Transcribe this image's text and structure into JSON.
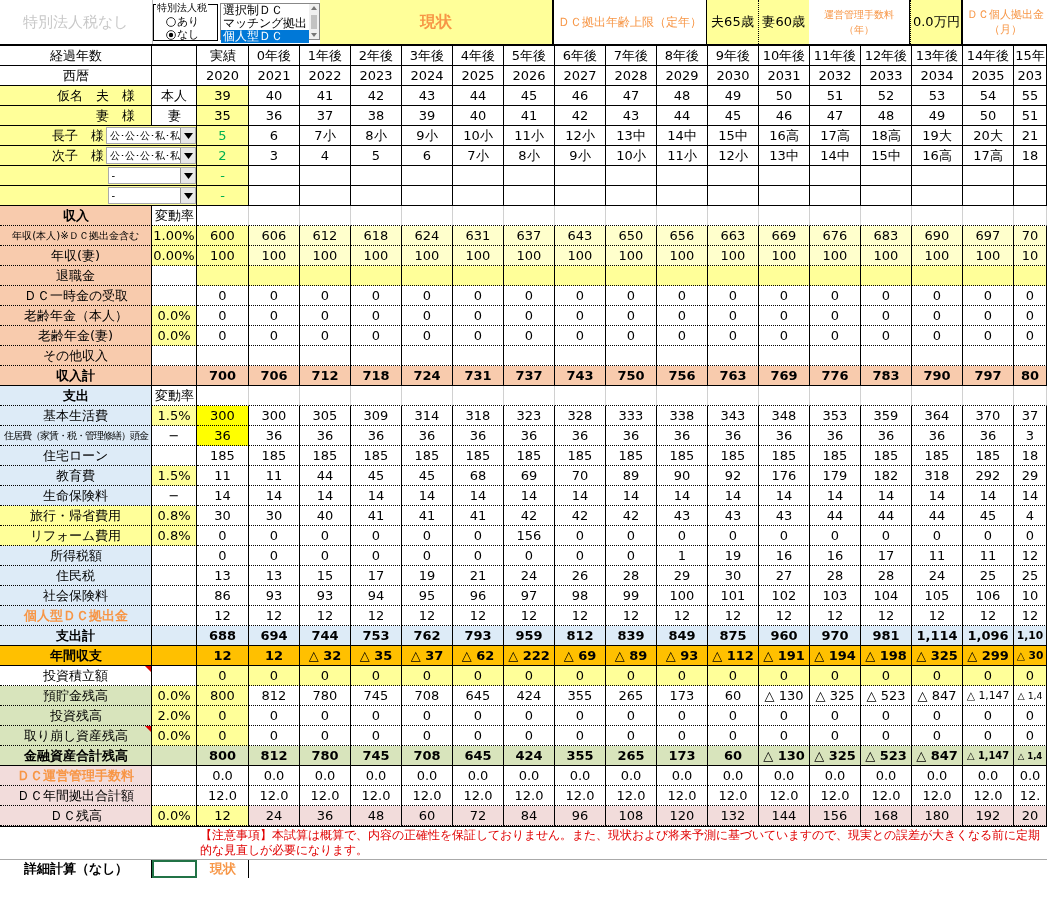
{
  "top_bar": {
    "notice": "特別法人税なし",
    "tax_option": {
      "title": "特別法人税",
      "options": [
        {
          "label": "あり",
          "selected": false
        },
        {
          "label": "なし",
          "selected": true
        }
      ]
    },
    "plan_list": [
      {
        "label": "選択制ＤＣ",
        "selected": false
      },
      {
        "label": "マッチング拠出",
        "selected": false
      },
      {
        "label": "個人型ＤＣ",
        "selected": true
      }
    ],
    "status": "現状",
    "dc_age_label": "ＤＣ拠出年齢上限（定年）",
    "husband_age": "夫65歳",
    "wife_age": "妻60歳",
    "fee_label": [
      "運営管理手数料",
      "（年）"
    ],
    "fee_value": "0.0万円",
    "contribution_label": [
      "ＤＣ個人拠出金",
      "（月）"
    ]
  },
  "elapsed_label": "経過年数",
  "year_label": "西暦",
  "columns": [
    "実績",
    "0年後",
    "1年後",
    "2年後",
    "3年後",
    "4年後",
    "5年後",
    "6年後",
    "7年後",
    "8年後",
    "9年後",
    "10年後",
    "11年後",
    "12年後",
    "13年後",
    "14年後",
    "15年"
  ],
  "years": [
    "2020",
    "2021",
    "2022",
    "2023",
    "2024",
    "2025",
    "2026",
    "2027",
    "2028",
    "2029",
    "2030",
    "2031",
    "2032",
    "2033",
    "2034",
    "2035",
    "203"
  ],
  "members": [
    {
      "kind": "adult",
      "name": "仮名　夫　様",
      "relation": "本人",
      "current": "39",
      "ages": [
        "40",
        "41",
        "42",
        "43",
        "44",
        "45",
        "46",
        "47",
        "48",
        "49",
        "50",
        "51",
        "52",
        "53",
        "54",
        "55"
      ]
    },
    {
      "kind": "adult",
      "name": "妻　様",
      "relation": "妻",
      "current": "35",
      "ages": [
        "36",
        "37",
        "38",
        "39",
        "40",
        "41",
        "42",
        "43",
        "44",
        "45",
        "46",
        "47",
        "48",
        "49",
        "50",
        "51"
      ]
    },
    {
      "kind": "child",
      "name": "長子　様",
      "school": "公･公･公･私･私",
      "current": "5",
      "ages": [
        "6",
        "7小",
        "8小",
        "9小",
        "10小",
        "11小",
        "12小",
        "13中",
        "14中",
        "15中",
        "16高",
        "17高",
        "18高",
        "19大",
        "20大",
        "21"
      ]
    },
    {
      "kind": "child",
      "name": "次子　様",
      "school": "公･公･公･私･私",
      "current": "2",
      "ages": [
        "3",
        "4",
        "5",
        "6",
        "7小",
        "8小",
        "9小",
        "10小",
        "11小",
        "12小",
        "13中",
        "14中",
        "15中",
        "16高",
        "17高",
        "18"
      ]
    },
    {
      "kind": "child",
      "school": "-",
      "current": "-"
    },
    {
      "kind": "child",
      "school": "-",
      "current": "-"
    }
  ],
  "rows": [
    {
      "kind": "heading-income",
      "label": "収入",
      "rate": "変動率",
      "note_mark": false
    },
    {
      "kind": "salary",
      "label": "年収(本人)※ＤＣ拠出金含む",
      "rate": "1.00%",
      "rate_input": true,
      "note_mark": false,
      "values": [
        "600",
        "606",
        "612",
        "618",
        "624",
        "631",
        "637",
        "643",
        "650",
        "656",
        "663",
        "669",
        "676",
        "683",
        "690",
        "697",
        "70"
      ]
    },
    {
      "kind": "salary",
      "label": "年収(妻)",
      "rate": "0.00%",
      "rate_input": true,
      "note_mark": false,
      "values": [
        "100",
        "100",
        "100",
        "100",
        "100",
        "100",
        "100",
        "100",
        "100",
        "100",
        "100",
        "100",
        "100",
        "100",
        "100",
        "100",
        "10"
      ]
    },
    {
      "kind": "lump",
      "label": "退職金",
      "note_mark": false
    },
    {
      "kind": "income",
      "label": "ＤＣ一時金の受取",
      "note_mark": false,
      "values": [
        "0",
        "0",
        "0",
        "0",
        "0",
        "0",
        "0",
        "0",
        "0",
        "0",
        "0",
        "0",
        "0",
        "0",
        "0",
        "0",
        "0"
      ]
    },
    {
      "kind": "income",
      "label": "老齢年金（本人）",
      "rate": "0.0%",
      "rate_input": true,
      "note_mark": false,
      "values": [
        "0",
        "0",
        "0",
        "0",
        "0",
        "0",
        "0",
        "0",
        "0",
        "0",
        "0",
        "0",
        "0",
        "0",
        "0",
        "0",
        "0"
      ]
    },
    {
      "kind": "income",
      "label": "老齢年金(妻)",
      "rate": "0.0%",
      "rate_input": true,
      "note_mark": false,
      "values": [
        "0",
        "0",
        "0",
        "0",
        "0",
        "0",
        "0",
        "0",
        "0",
        "0",
        "0",
        "0",
        "0",
        "0",
        "0",
        "0",
        "0"
      ]
    },
    {
      "kind": "income",
      "label": "その他収入",
      "note_mark": false
    },
    {
      "kind": "income-total",
      "label": "収入計",
      "note_mark": false,
      "values": [
        "700",
        "706",
        "712",
        "718",
        "724",
        "731",
        "737",
        "743",
        "750",
        "756",
        "763",
        "769",
        "776",
        "783",
        "790",
        "797",
        "80"
      ]
    },
    {
      "kind": "heading-expense",
      "label": "支出",
      "rate": "変動率",
      "note_mark": false
    },
    {
      "kind": "expense-input",
      "label": "基本生活費",
      "rate": "1.5%",
      "rate_input": true,
      "note_mark": false,
      "values": [
        "300",
        "300",
        "305",
        "309",
        "314",
        "318",
        "323",
        "328",
        "333",
        "338",
        "343",
        "348",
        "353",
        "359",
        "364",
        "370",
        "37"
      ]
    },
    {
      "kind": "expense-input",
      "label": "住居費（家賃・税・管理修繕）頭金",
      "rate": "−",
      "rate_input": false,
      "note_mark": false,
      "values": [
        "36",
        "36",
        "36",
        "36",
        "36",
        "36",
        "36",
        "36",
        "36",
        "36",
        "36",
        "36",
        "36",
        "36",
        "36",
        "36",
        "3"
      ]
    },
    {
      "kind": "expense",
      "label": "住宅ローン",
      "note_mark": false,
      "values": [
        "185",
        "185",
        "185",
        "185",
        "185",
        "185",
        "185",
        "185",
        "185",
        "185",
        "185",
        "185",
        "185",
        "185",
        "185",
        "185",
        "18"
      ]
    },
    {
      "kind": "expense",
      "label": "教育費",
      "rate": "1.5%",
      "rate_input": true,
      "note_mark": false,
      "values": [
        "11",
        "11",
        "44",
        "45",
        "45",
        "68",
        "69",
        "70",
        "89",
        "90",
        "92",
        "176",
        "179",
        "182",
        "318",
        "292",
        "29"
      ]
    },
    {
      "kind": "expense",
      "label": "生命保険料",
      "rate": "−",
      "rate_input": false,
      "note_mark": false,
      "values": [
        "14",
        "14",
        "14",
        "14",
        "14",
        "14",
        "14",
        "14",
        "14",
        "14",
        "14",
        "14",
        "14",
        "14",
        "14",
        "14",
        "14"
      ]
    },
    {
      "kind": "expense-alt",
      "label": "旅行・帰省費用",
      "rate": "0.8%",
      "rate_input": true,
      "note_mark": false,
      "values": [
        "30",
        "30",
        "40",
        "41",
        "41",
        "41",
        "42",
        "42",
        "42",
        "43",
        "43",
        "43",
        "44",
        "44",
        "44",
        "45",
        "4"
      ]
    },
    {
      "kind": "expense-alt",
      "label": "リフォーム費用",
      "rate": "0.8%",
      "rate_input": true,
      "note_mark": false,
      "values": [
        "0",
        "0",
        "0",
        "0",
        "0",
        "0",
        "156",
        "0",
        "0",
        "0",
        "0",
        "0",
        "0",
        "0",
        "0",
        "0",
        "0"
      ]
    },
    {
      "kind": "expense",
      "label": "所得税額",
      "note_mark": false,
      "values": [
        "0",
        "0",
        "0",
        "0",
        "0",
        "0",
        "0",
        "0",
        "0",
        "1",
        "19",
        "16",
        "16",
        "17",
        "11",
        "11",
        "12"
      ]
    },
    {
      "kind": "expense",
      "label": "住民税",
      "note_mark": false,
      "values": [
        "13",
        "13",
        "15",
        "17",
        "19",
        "21",
        "24",
        "26",
        "28",
        "29",
        "30",
        "27",
        "28",
        "28",
        "24",
        "25",
        "25"
      ]
    },
    {
      "kind": "expense",
      "label": "社会保険料",
      "note_mark": false,
      "values": [
        "86",
        "93",
        "93",
        "94",
        "95",
        "96",
        "97",
        "98",
        "99",
        "100",
        "101",
        "102",
        "103",
        "104",
        "105",
        "106",
        "10"
      ]
    },
    {
      "kind": "expense-dc",
      "label": "個人型ＤＣ拠出金",
      "note_mark": false,
      "values": [
        "12",
        "12",
        "12",
        "12",
        "12",
        "12",
        "12",
        "12",
        "12",
        "12",
        "12",
        "12",
        "12",
        "12",
        "12",
        "12",
        "12"
      ]
    },
    {
      "kind": "expense-total",
      "label": "支出計",
      "note_mark": false,
      "values": [
        "688",
        "694",
        "744",
        "753",
        "762",
        "793",
        "959",
        "812",
        "839",
        "849",
        "875",
        "960",
        "970",
        "981",
        "1,114",
        "1,096",
        "1,10"
      ]
    },
    {
      "kind": "net",
      "label": "年間収支",
      "note_mark": false,
      "values": [
        "12",
        "12",
        "△ 32",
        "△ 35",
        "△ 37",
        "△ 62",
        "△ 222",
        "△ 69",
        "△ 89",
        "△ 93",
        "△ 112",
        "△ 191",
        "△ 194",
        "△ 198",
        "△ 325",
        "△ 299",
        "△ 30"
      ]
    },
    {
      "kind": "invest",
      "label": "投資積立額",
      "note_mark": true,
      "values": [
        "0",
        "0",
        "0",
        "0",
        "0",
        "0",
        "0",
        "0",
        "0",
        "0",
        "0",
        "0",
        "0",
        "0",
        "0",
        "0",
        "0"
      ]
    },
    {
      "kind": "asset-input",
      "label": "預貯金残高",
      "rate": "0.0%",
      "rate_input": true,
      "note_mark": false,
      "values": [
        "800",
        "812",
        "780",
        "745",
        "708",
        "645",
        "424",
        "355",
        "265",
        "173",
        "60",
        "△ 130",
        "△ 325",
        "△ 523",
        "△ 847",
        "△ 1,147",
        "△ 1,4"
      ]
    },
    {
      "kind": "asset-input",
      "label": "投資残高",
      "rate": "2.0%",
      "rate_input": true,
      "note_mark": false,
      "values": [
        "0",
        "0",
        "0",
        "0",
        "0",
        "0",
        "0",
        "0",
        "0",
        "0",
        "0",
        "0",
        "0",
        "0",
        "0",
        "0",
        "0"
      ]
    },
    {
      "kind": "asset-input",
      "label": "取り崩し資産残高",
      "rate": "0.0%",
      "rate_input": true,
      "note_mark": true,
      "values": [
        "0",
        "0",
        "0",
        "0",
        "0",
        "0",
        "0",
        "0",
        "0",
        "0",
        "0",
        "0",
        "0",
        "0",
        "0",
        "0",
        "0"
      ]
    },
    {
      "kind": "asset-total",
      "label": "金融資産合計残高",
      "note_mark": false,
      "values": [
        "800",
        "812",
        "780",
        "745",
        "708",
        "645",
        "424",
        "355",
        "265",
        "173",
        "60",
        "△ 130",
        "△ 325",
        "△ 523",
        "△ 847",
        "△ 1,147",
        "△ 1,4"
      ]
    },
    {
      "kind": "dc-fee",
      "label": "ＤＣ運営管理手数料",
      "note_mark": false,
      "values": [
        "0.0",
        "0.0",
        "0.0",
        "0.0",
        "0.0",
        "0.0",
        "0.0",
        "0.0",
        "0.0",
        "0.0",
        "0.0",
        "0.0",
        "0.0",
        "0.0",
        "0.0",
        "0.0",
        "0.0"
      ]
    },
    {
      "kind": "dc",
      "label": "ＤＣ年間拠出合計額",
      "note_mark": false,
      "values": [
        "12.0",
        "12.0",
        "12.0",
        "12.0",
        "12.0",
        "12.0",
        "12.0",
        "12.0",
        "12.0",
        "12.0",
        "12.0",
        "12.0",
        "12.0",
        "12.0",
        "12.0",
        "12.0",
        "12."
      ]
    },
    {
      "kind": "dc-balance",
      "label": "ＤＣ残高",
      "rate": "0.0%",
      "rate_input": true,
      "note_mark": false,
      "values": [
        "12",
        "24",
        "36",
        "48",
        "60",
        "72",
        "84",
        "96",
        "108",
        "120",
        "132",
        "144",
        "156",
        "168",
        "180",
        "192",
        "20"
      ]
    }
  ],
  "notice": "【注意事項】本試算は概算で、内容の正確性を保証しておりません。また、現状および将来予測に基づいていますので、現実との誤差が大きくなる前に定期的な見直しが必要になります。",
  "detail": {
    "label": "詳細計算（なし）",
    "status": "現状"
  }
}
